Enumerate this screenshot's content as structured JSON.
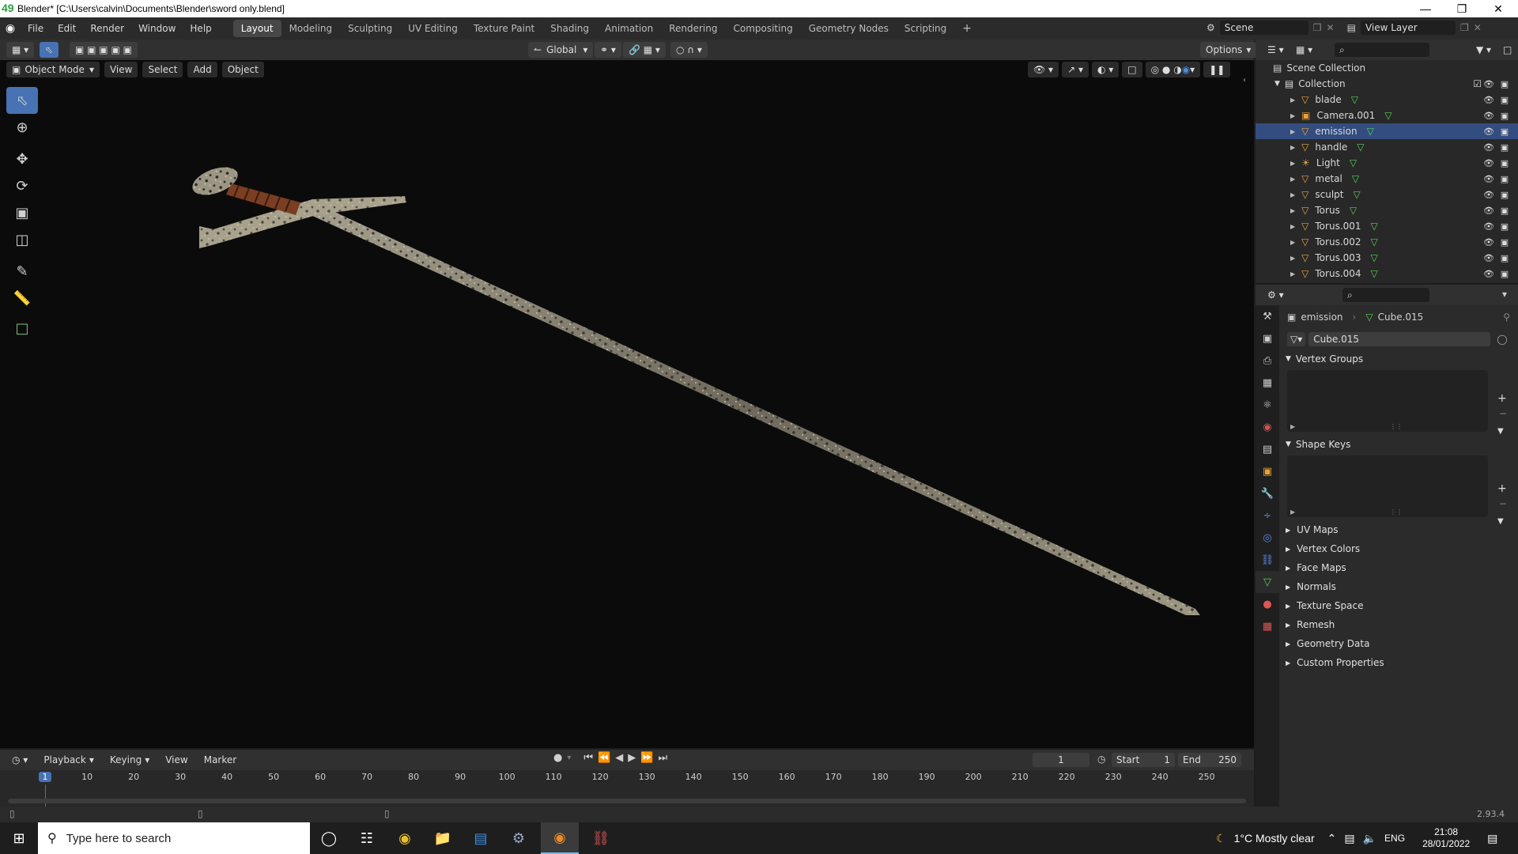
{
  "window": {
    "title": "Blender* [C:\\Users\\calvin\\Documents\\Blender\\sword only.blend]",
    "fps_overlay": "49"
  },
  "menu": [
    "File",
    "Edit",
    "Render",
    "Window",
    "Help"
  ],
  "workspaces": [
    "Layout",
    "Modeling",
    "Sculpting",
    "UV Editing",
    "Texture Paint",
    "Shading",
    "Animation",
    "Rendering",
    "Compositing",
    "Geometry Nodes",
    "Scripting"
  ],
  "active_workspace": "Layout",
  "scene": {
    "label": "Scene",
    "view_layer": "View Layer"
  },
  "tool_header": {
    "orientation": "Global",
    "options": "Options"
  },
  "viewport_header": {
    "mode": "Object Mode",
    "menus": [
      "View",
      "Select",
      "Add",
      "Object"
    ]
  },
  "outliner": {
    "root": "Scene Collection",
    "collection": "Collection",
    "items": [
      {
        "name": "blade",
        "icon": "mesh-icon"
      },
      {
        "name": "Camera.001",
        "icon": "camera-icon"
      },
      {
        "name": "emission",
        "icon": "mesh-icon",
        "selected": true
      },
      {
        "name": "handle",
        "icon": "mesh-icon"
      },
      {
        "name": "Light",
        "icon": "light-icon"
      },
      {
        "name": "metal",
        "icon": "mesh-icon"
      },
      {
        "name": "sculpt",
        "icon": "mesh-icon"
      },
      {
        "name": "Torus",
        "icon": "mesh-icon"
      },
      {
        "name": "Torus.001",
        "icon": "mesh-icon"
      },
      {
        "name": "Torus.002",
        "icon": "mesh-icon"
      },
      {
        "name": "Torus.003",
        "icon": "mesh-icon"
      },
      {
        "name": "Torus.004",
        "icon": "mesh-icon"
      }
    ]
  },
  "properties": {
    "object": "emission",
    "mesh": "Cube.015",
    "datablock": "Cube.015",
    "panels_open": [
      "Vertex Groups",
      "Shape Keys"
    ],
    "panels_closed": [
      "UV Maps",
      "Vertex Colors",
      "Face Maps",
      "Normals",
      "Texture Space",
      "Remesh",
      "Geometry Data",
      "Custom Properties"
    ]
  },
  "timeline": {
    "menus": [
      "Playback",
      "Keying",
      "View",
      "Marker"
    ],
    "current_frame": "1",
    "start_label": "Start",
    "start": "1",
    "end_label": "End",
    "end": "250",
    "ruler": [
      "1",
      "10",
      "20",
      "30",
      "40",
      "50",
      "60",
      "70",
      "80",
      "90",
      "100",
      "110",
      "120",
      "130",
      "140",
      "150",
      "160",
      "170",
      "180",
      "190",
      "200",
      "210",
      "220",
      "230",
      "240",
      "250"
    ]
  },
  "status": {
    "version": "2.93.4"
  },
  "taskbar": {
    "search_placeholder": "Type here to search",
    "weather": "1°C  Mostly clear",
    "lang": "ENG",
    "time": "21:08",
    "date": "28/01/2022"
  },
  "colors": {
    "accent": "#4772b3",
    "selected_row": "#334d80",
    "mesh_icon": "#e8a23a",
    "data_icon": "#5bd15b"
  }
}
